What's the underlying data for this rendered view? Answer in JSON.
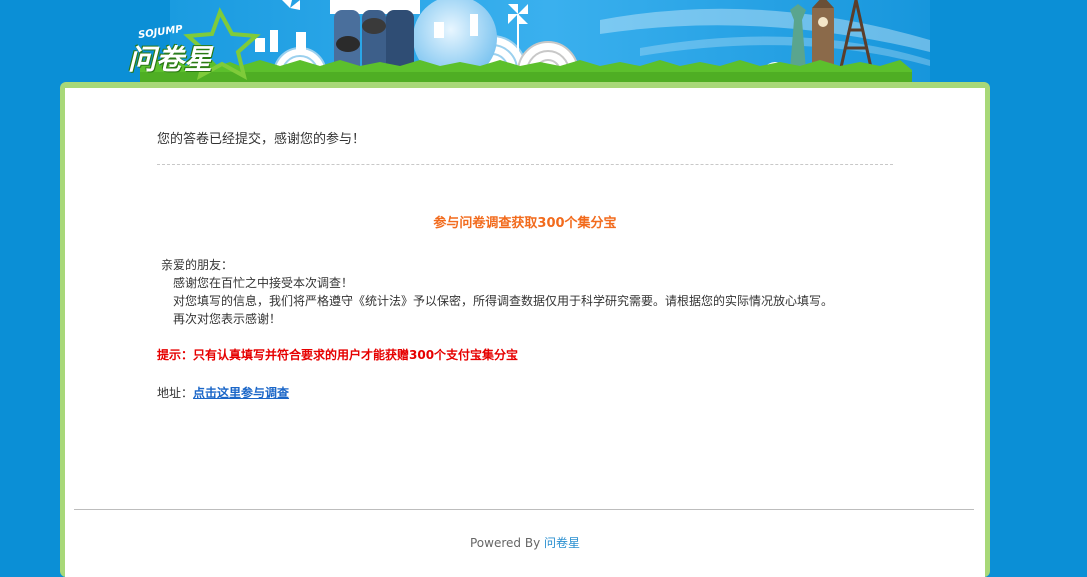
{
  "banner": {
    "logo_text": "问卷星",
    "logo_sub": "SOJUMP"
  },
  "main": {
    "submitted_msg": "您的答卷已经提交，感谢您的参与！",
    "promo_title": "参与问卷调查获取300个集分宝",
    "greeting": "亲爱的朋友：",
    "lines": [
      "感谢您在百忙之中接受本次调查！",
      "对您填写的信息，我们将严格遵守《统计法》予以保密，所得调查数据仅用于科学研究需要。请根据您的实际情况放心填写。",
      "再次对您表示感谢！"
    ],
    "tip": "提示：只有认真填写并符合要求的用户才能获赠300个支付宝集分宝",
    "address_label": "地址：",
    "address_link": "点击这里参与调查"
  },
  "footer": {
    "powered_by": "Powered By ",
    "brand": "问卷星"
  },
  "colors": {
    "background": "#0b8fd6",
    "card_border": "#a8d878",
    "promo": "#f26b1d",
    "tip": "#e60000",
    "link": "#1a66c8"
  }
}
